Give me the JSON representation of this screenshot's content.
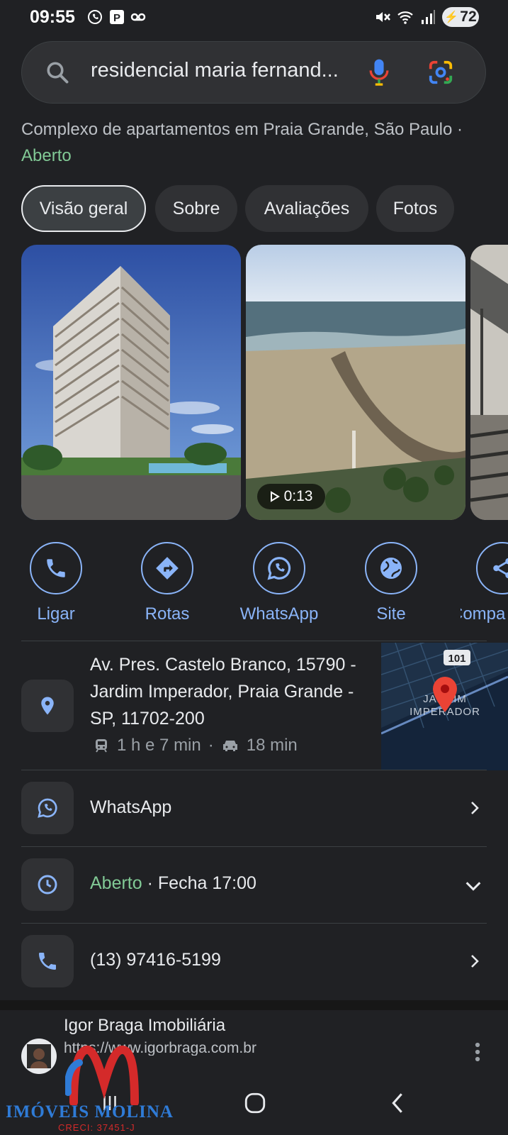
{
  "status_bar": {
    "time": "09:55",
    "battery": "72"
  },
  "search": {
    "query": "residencial maria fernand..."
  },
  "place": {
    "type_text": "Complexo de apartamentos em Praia Grande, São Paulo · ",
    "status": "Aberto"
  },
  "tabs": [
    {
      "label": "Visão geral"
    },
    {
      "label": "Sobre"
    },
    {
      "label": "Avaliações"
    },
    {
      "label": "Fotos"
    }
  ],
  "photos": {
    "video_duration": "0:13"
  },
  "actions": [
    {
      "label": "Ligar"
    },
    {
      "label": "Rotas"
    },
    {
      "label": "WhatsApp"
    },
    {
      "label": "Site"
    },
    {
      "label": "Compa"
    }
  ],
  "address": {
    "text": "Av. Pres. Castelo Branco, 15790 - Jardim Imperador, Praia Grande - SP, 11702-200",
    "transit_time": "1 h e 7 min",
    "drive_time": "18 min",
    "map_label_line1": "JARDIM",
    "map_label_line2": "IMPERADOR",
    "map_road": "101"
  },
  "rows": {
    "whatsapp": "WhatsApp",
    "hours_status": "Aberto",
    "hours_close": " · Fecha 17:00",
    "phone": "(13) 97416-5199"
  },
  "result": {
    "title": "Igor Braga Imobiliária",
    "url": "https://www.igorbraga.com.br"
  },
  "watermark": {
    "brand": "IMÓVEIS MOLINA",
    "creci": "CRECI: 37451-J"
  },
  "colors": {
    "background": "#202124",
    "accent": "#8ab4f8",
    "open": "#81c995",
    "pin": "#ea4335"
  }
}
